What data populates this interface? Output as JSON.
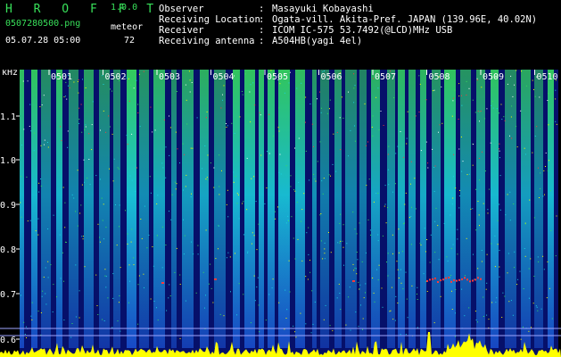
{
  "app": {
    "name": "H R O F F T",
    "version": "1.0.0",
    "filename": "0507280500.png",
    "datetime": "05.07.28 05:00",
    "counter_label": "meteor",
    "counter_value": "72"
  },
  "info": {
    "rows": [
      {
        "label": "Observer",
        "value": "Masayuki Kobayashi"
      },
      {
        "label": "Receiving Location",
        "value": "Ogata-vill. Akita-Pref. JAPAN (139.96E, 40.02N)"
      },
      {
        "label": "Receiver",
        "value": "ICOM IC-575 53.7492(@LCD)MHz USB"
      },
      {
        "label": "Receiving antenna",
        "value": "A504HB(yagi 4el)"
      }
    ]
  },
  "spectrogram": {
    "unit_label": "kHz",
    "y_ticks": [
      "1.1",
      "1.0",
      "0.9",
      "0.8",
      "0.7",
      "0.6"
    ],
    "x_markers": [
      "0501",
      "0502",
      "0503",
      "0504",
      "0505",
      "0506",
      "0507",
      "0508",
      "0509",
      "0510"
    ],
    "colors": {
      "bg": "#06106a",
      "cyan": "#1ad3e0",
      "green": "#38e05a",
      "yellow": "#ffff00",
      "red": "#ff3a3a",
      "marker": "#ffffff"
    }
  }
}
